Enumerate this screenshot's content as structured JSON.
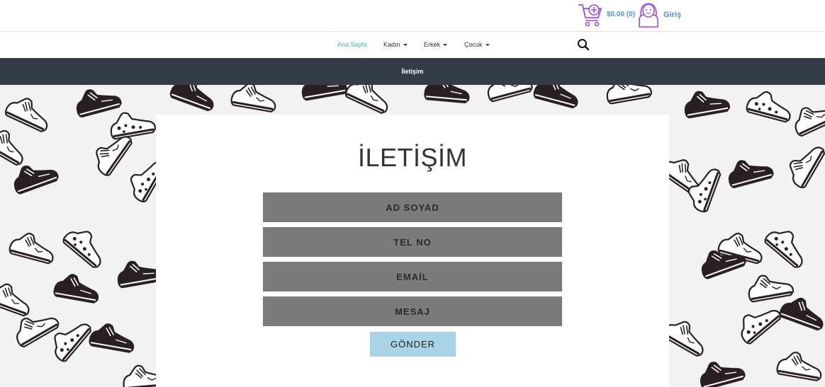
{
  "header": {
    "cart_total": "$0.00 (0)",
    "login_label": "Giriş",
    "cart_icon": "cart-icon",
    "user_icon": "user-avatar-icon"
  },
  "nav": {
    "items": [
      {
        "label": "Ana Sayfa",
        "active": true,
        "dropdown": false
      },
      {
        "label": "Kadın",
        "active": false,
        "dropdown": true
      },
      {
        "label": "Erkek",
        "active": false,
        "dropdown": true
      },
      {
        "label": "Çocuk",
        "active": false,
        "dropdown": true
      }
    ],
    "search_icon": "search-icon"
  },
  "subnav": {
    "label": "İletişim"
  },
  "contact": {
    "title": "İLETİŞİM",
    "fields": [
      {
        "placeholder": "AD SOYAD"
      },
      {
        "placeholder": "TEL NO"
      },
      {
        "placeholder": "EMAİL"
      },
      {
        "placeholder": "MESAJ"
      }
    ],
    "submit_label": "GÖNDER"
  },
  "colors": {
    "accent": "#3aaee0",
    "link": "#5a8fd6",
    "dark_bar": "#333c47",
    "field_bg": "#7b7b7b",
    "button_bg": "#a8d4e5",
    "icon_purple": "#a04de0"
  }
}
